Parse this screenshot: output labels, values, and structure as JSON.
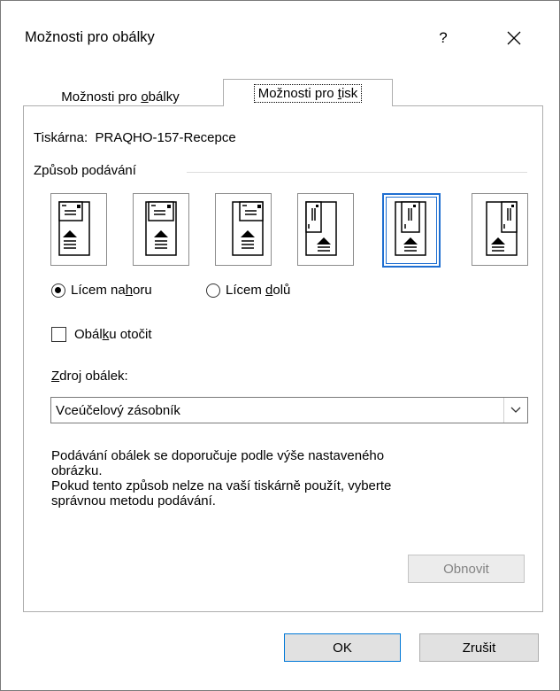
{
  "window": {
    "title": "Možnosti pro obálky",
    "help": "?"
  },
  "tabs": [
    {
      "pre": "Možnosti pro ",
      "key": "o",
      "post": "bálky",
      "active": false
    },
    {
      "pre": "Možnosti pro ",
      "key": "t",
      "post": "isk",
      "active": true
    }
  ],
  "printer": {
    "label": "Tiskárna:",
    "name": "PRAQHO-157-Recepce"
  },
  "feed": {
    "group_label": "Způsob podávání",
    "selected_index": 4,
    "options": [
      {
        "icon": "feed-horizontal-left-icon"
      },
      {
        "icon": "feed-horizontal-center-icon"
      },
      {
        "icon": "feed-horizontal-right-icon"
      },
      {
        "icon": "feed-vertical-left-icon"
      },
      {
        "icon": "feed-vertical-center-icon"
      },
      {
        "icon": "feed-vertical-right-icon"
      }
    ]
  },
  "face": {
    "up": {
      "pre": "Lícem na",
      "key": "h",
      "post": "oru",
      "checked": true
    },
    "down": {
      "pre": "Lícem ",
      "key": "d",
      "post": "olů",
      "checked": false
    }
  },
  "rotate": {
    "pre": "Obál",
    "key": "k",
    "post": "u otočit",
    "checked": false
  },
  "source": {
    "label_key": "Z",
    "label_rest": "droj obálek:",
    "value": "Vceúčelový zásobník"
  },
  "hint": {
    "line1": "Podávání obálek se doporučuje podle výše nastaveného",
    "line2": "obrázku.",
    "line3": "Pokud tento způsob nelze na vaší tiskárně použít, vyberte",
    "line4": "správnou metodu podávání."
  },
  "buttons": {
    "reset": "Obnovit",
    "ok": "OK",
    "cancel": "Zrušit"
  },
  "colors": {
    "accent": "#0078d7",
    "selection": "#1f6fd1"
  }
}
